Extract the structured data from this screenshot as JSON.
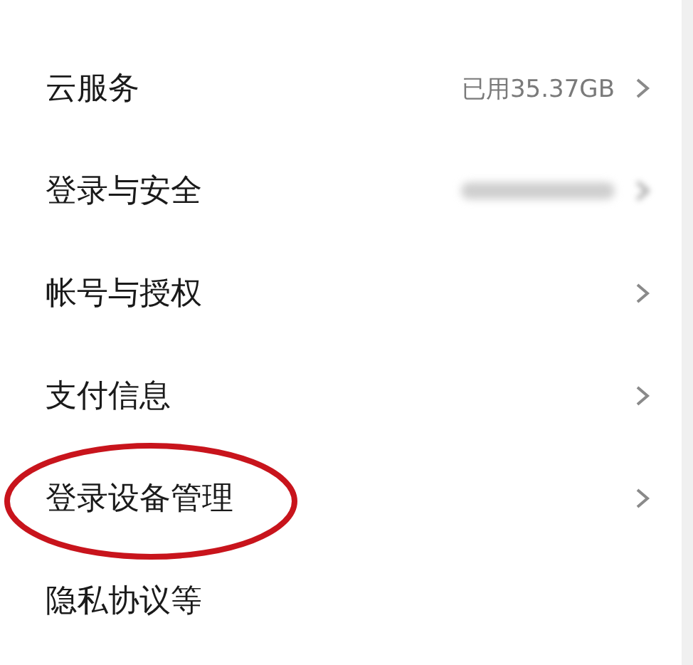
{
  "settings_list": [
    {
      "label": "云服务",
      "value": "已用35.37GB",
      "chevron": true,
      "highlighted": false
    },
    {
      "label": "登录与安全",
      "masked": true,
      "chevron": true,
      "highlighted": false
    },
    {
      "label": "帐号与授权",
      "chevron": true,
      "highlighted": false
    },
    {
      "label": "支付信息",
      "chevron": true,
      "highlighted": false
    },
    {
      "label": "登录设备管理",
      "chevron": true,
      "highlighted": true
    },
    {
      "label": "隐私协议等",
      "chevron": false,
      "highlighted": false
    }
  ]
}
